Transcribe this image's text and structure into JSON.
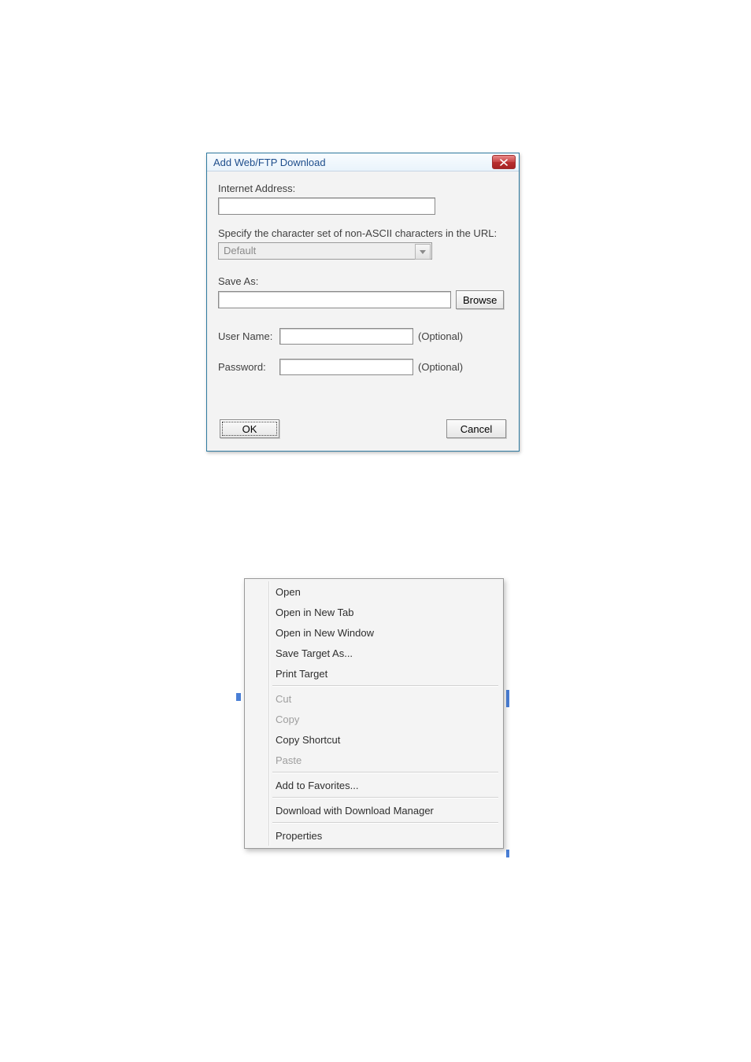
{
  "dialog": {
    "title": "Add Web/FTP Download",
    "labels": {
      "internet_address": "Internet Address:",
      "charset": "Specify the character set of non-ASCII characters in the URL:",
      "save_as": "Save As:",
      "user_name": "User Name:",
      "password": "Password:",
      "optional": "(Optional)"
    },
    "values": {
      "internet_address": "",
      "charset_selected": "Default",
      "save_as": "",
      "user_name": "",
      "password": ""
    },
    "buttons": {
      "browse": "Browse",
      "ok": "OK",
      "cancel": "Cancel"
    }
  },
  "context_menu": {
    "items": [
      {
        "label": "Open",
        "disabled": false
      },
      {
        "label": "Open in New Tab",
        "disabled": false
      },
      {
        "label": "Open in New Window",
        "disabled": false
      },
      {
        "label": "Save Target As...",
        "disabled": false
      },
      {
        "label": "Print Target",
        "disabled": false
      },
      {
        "sep": true
      },
      {
        "label": "Cut",
        "disabled": true
      },
      {
        "label": "Copy",
        "disabled": true
      },
      {
        "label": "Copy Shortcut",
        "disabled": false
      },
      {
        "label": "Paste",
        "disabled": true
      },
      {
        "sep": true
      },
      {
        "label": "Add to Favorites...",
        "disabled": false
      },
      {
        "sep": true
      },
      {
        "label": "Download with Download Manager",
        "disabled": false
      },
      {
        "sep": true
      },
      {
        "label": "Properties",
        "disabled": false
      }
    ]
  }
}
